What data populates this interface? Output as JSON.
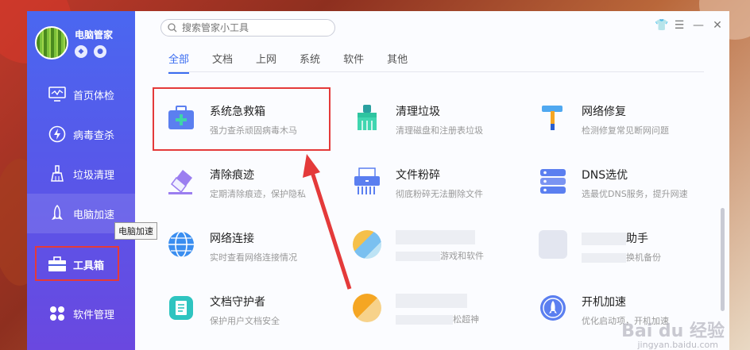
{
  "app": {
    "name": "电脑管家"
  },
  "search": {
    "placeholder": "搜索管家小工具"
  },
  "tabs": [
    {
      "label": "全部",
      "active": true
    },
    {
      "label": "文档",
      "active": false
    },
    {
      "label": "上网",
      "active": false
    },
    {
      "label": "系统",
      "active": false
    },
    {
      "label": "软件",
      "active": false
    },
    {
      "label": "其他",
      "active": false
    }
  ],
  "sidebar": {
    "items": [
      {
        "label": "首页体检",
        "icon": "monitor-icon"
      },
      {
        "label": "病毒查杀",
        "icon": "bolt-icon"
      },
      {
        "label": "垃圾清理",
        "icon": "broom-icon"
      },
      {
        "label": "电脑加速",
        "icon": "rocket-icon"
      },
      {
        "label": "工具箱",
        "icon": "toolbox-icon"
      },
      {
        "label": "软件管理",
        "icon": "apps-icon"
      }
    ]
  },
  "tooltip": {
    "text": "电脑加速"
  },
  "tools": [
    {
      "name": "系统急救箱",
      "desc": "强力查杀顽固病毒木马",
      "icon": "first-aid-kit-icon"
    },
    {
      "name": "清理垃圾",
      "desc": "清理磁盘和注册表垃圾",
      "icon": "brush-icon"
    },
    {
      "name": "网络修复",
      "desc": "检测修复常见断网问题",
      "icon": "hammer-icon"
    },
    {
      "name": "清除痕迹",
      "desc": "定期清除痕迹，保护隐私",
      "icon": "eraser-icon"
    },
    {
      "name": "文件粉碎",
      "desc": "彻底粉碎无法删除文件",
      "icon": "shredder-icon"
    },
    {
      "name": "DNS选优",
      "desc": "选最优DNS服务，提升网速",
      "icon": "server-icon"
    },
    {
      "name": "网络连接",
      "desc": "实时查看网络连接情况",
      "icon": "globe-icon"
    },
    {
      "name": "",
      "desc": "游戏和软件",
      "icon": "blurred-icon"
    },
    {
      "name": "助手",
      "desc": "换机备份",
      "icon": "blurred-icon"
    },
    {
      "name": "文档守护者",
      "desc": "保护用户文档安全",
      "icon": "document-icon"
    },
    {
      "name": "",
      "desc": "松超神",
      "icon": "blurred-icon"
    },
    {
      "name": "开机加速",
      "desc": "优化启动项，开机加速",
      "icon": "rocket-circle-icon"
    }
  ],
  "watermark": {
    "text": "Bai du 经验",
    "url": "jingyan.baidu.com"
  }
}
